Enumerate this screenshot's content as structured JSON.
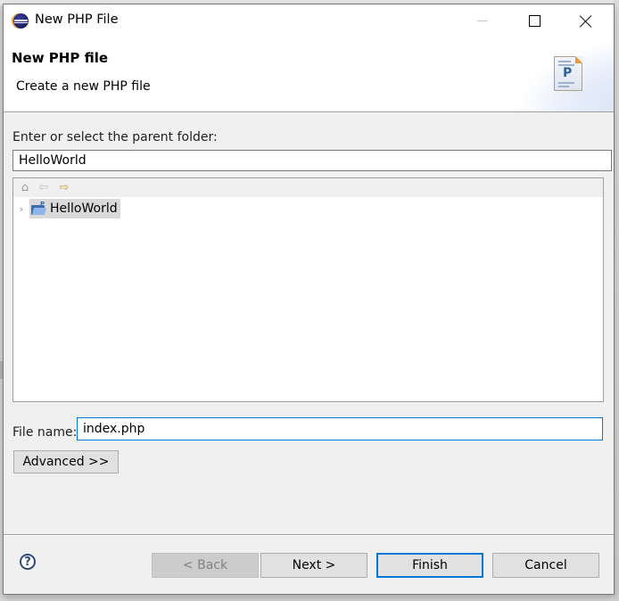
{
  "window": {
    "title": "New PHP File",
    "controls": {
      "minimize": "minimize",
      "maximize": "maximize",
      "close": "close"
    }
  },
  "banner": {
    "title": "New PHP file",
    "description": "Create a new PHP file",
    "icon": "php-file-icon",
    "icon_letter": "P"
  },
  "parent_folder": {
    "label": "Enter or select the parent folder:",
    "value": "HelloWorld"
  },
  "tree": {
    "toolbar": {
      "home_icon": "⌂",
      "back_icon": "⇦",
      "forward_icon": "⇨"
    },
    "items": [
      {
        "label": "HelloWorld",
        "expander": "›",
        "selected": true
      }
    ]
  },
  "file_name": {
    "label": "File name:",
    "value": "index.php"
  },
  "advanced_button": "Advanced >>",
  "footer": {
    "help_icon": "?",
    "back": "< Back",
    "next": "Next >",
    "finish": "Finish",
    "cancel": "Cancel"
  },
  "colors": {
    "focus_accent": "#0078d7",
    "dialog_bg": "#f0f0f0",
    "disabled_button_bg": "#cccccc"
  }
}
